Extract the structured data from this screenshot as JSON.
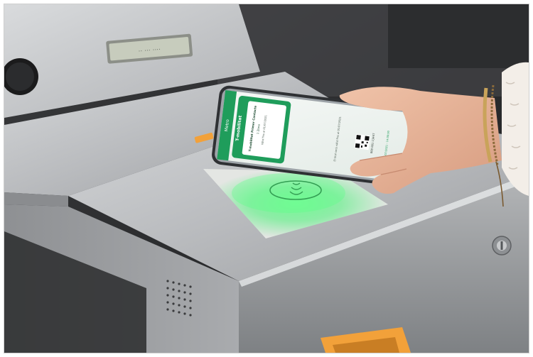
{
  "scene": {
    "subject": "smartphone tapped on NFC reader of a transit turnstile",
    "colors": {
      "steel_light": "#c9cbcd",
      "steel_mid": "#a7a9ab",
      "steel_dark": "#6b6e71",
      "background_dark": "#2a2b2d",
      "reader_glow": "#39f26c",
      "app_green": "#1f9d5b",
      "orange_indicator": "#f2a13a",
      "skin": "#e7b49a"
    }
  },
  "phone_screen": {
    "header_label": "Metro",
    "side_label": "T-mobilitat",
    "card_title": "T-mobilitat Primer Contacte",
    "card_subtitle": "1 Zona",
    "card_validity": "Vàlid fins al 01/07/2021",
    "detail_text": "El títol serà vàlid fins al 01/07/2021",
    "number_text": "000 001 13447",
    "date_text": "01/07/2021 - 14:00:00"
  },
  "display": {
    "text": "·· ··· ····"
  }
}
